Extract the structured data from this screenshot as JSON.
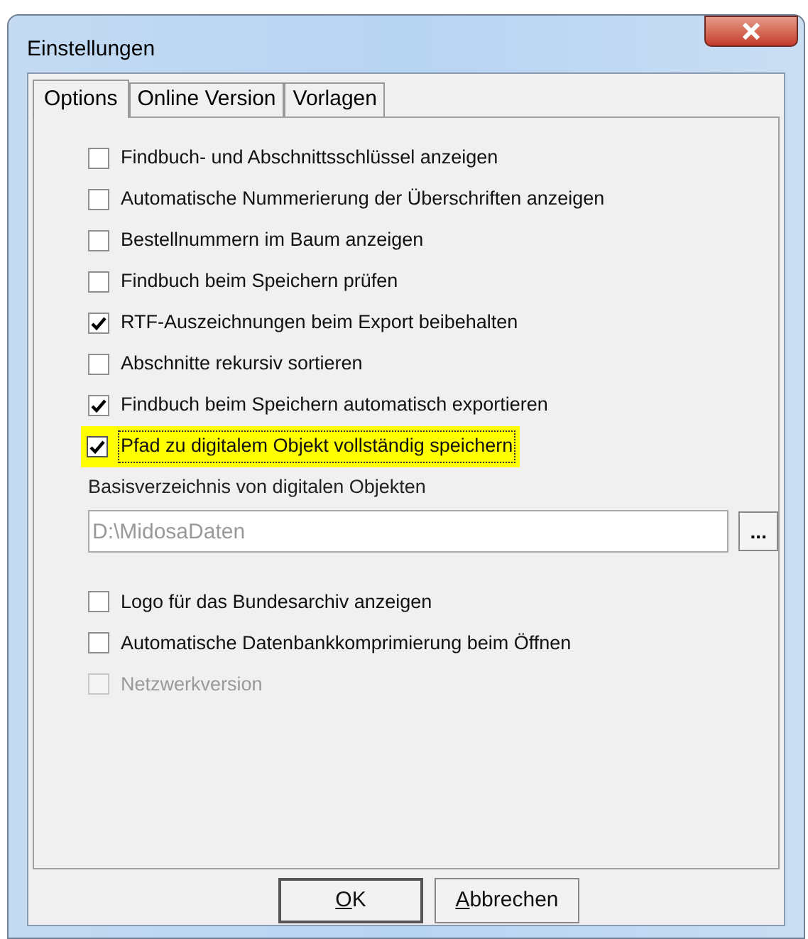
{
  "window": {
    "title": "Einstellungen"
  },
  "tabs": [
    {
      "label": "Options",
      "selected": true
    },
    {
      "label": "Online Version",
      "selected": false
    },
    {
      "label": "Vorlagen",
      "selected": false
    }
  ],
  "options": [
    {
      "label": "Findbuch- und Abschnittsschlüssel anzeigen",
      "checked": false,
      "disabled": false,
      "highlighted": false
    },
    {
      "label": "Automatische Nummerierung der Überschriften anzeigen",
      "checked": false,
      "disabled": false,
      "highlighted": false
    },
    {
      "label": "Bestellnummern im Baum anzeigen",
      "checked": false,
      "disabled": false,
      "highlighted": false
    },
    {
      "label": "Findbuch beim Speichern prüfen",
      "checked": false,
      "disabled": false,
      "highlighted": false
    },
    {
      "label": "RTF-Auszeichnungen beim Export beibehalten",
      "checked": true,
      "disabled": false,
      "highlighted": false
    },
    {
      "label": "Abschnitte rekursiv sortieren",
      "checked": false,
      "disabled": false,
      "highlighted": false
    },
    {
      "label": "Findbuch beim Speichern automatisch exportieren",
      "checked": true,
      "disabled": false,
      "highlighted": false
    },
    {
      "label": "Pfad zu digitalem Objekt vollständig speichern",
      "checked": true,
      "disabled": false,
      "highlighted": true
    }
  ],
  "base_directory": {
    "label": "Basisverzeichnis von digitalen Objekten",
    "value": "D:\\MidosaDaten",
    "browse_button": "..."
  },
  "more_options": [
    {
      "label": "Logo für das Bundesarchiv anzeigen",
      "checked": false,
      "disabled": false,
      "highlighted": false
    },
    {
      "label": "Automatische Datenbankkomprimierung beim Öffnen",
      "checked": false,
      "disabled": false,
      "highlighted": false
    },
    {
      "label": "Netzwerkversion",
      "checked": false,
      "disabled": true,
      "highlighted": false
    }
  ],
  "buttons": [
    {
      "label": "OK",
      "default": true,
      "first_letter_underlined": true
    },
    {
      "label": "Abbrechen",
      "default": false,
      "first_letter_underlined": true
    }
  ]
}
